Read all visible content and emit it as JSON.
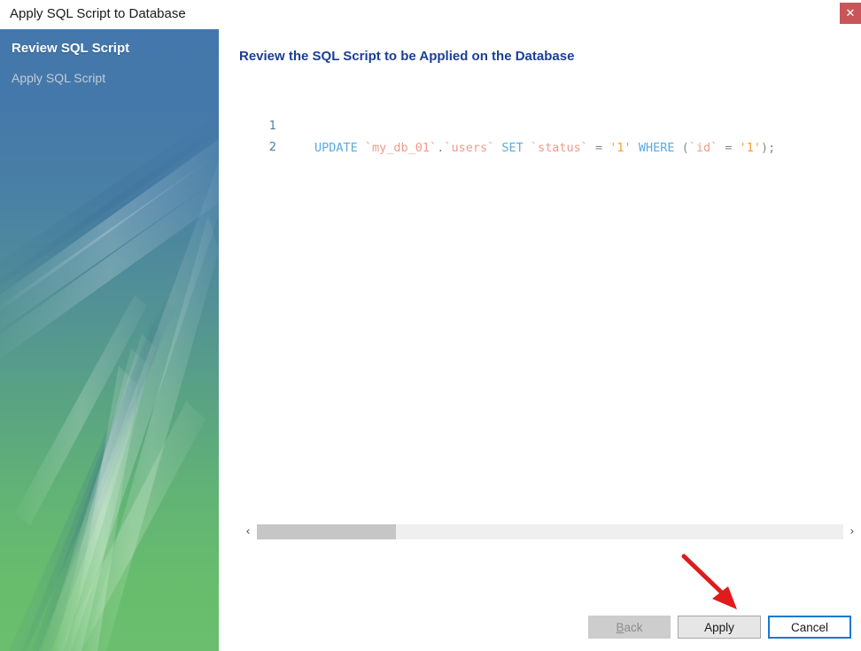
{
  "window": {
    "title": "Apply SQL Script to Database",
    "close_label": "✕",
    "close_color": "#c9555a"
  },
  "sidebar": {
    "steps": [
      {
        "label": "Review SQL Script",
        "state": "active"
      },
      {
        "label": "Apply SQL Script",
        "state": "inactive"
      }
    ],
    "gradient_from": "#4477ab",
    "gradient_to": "#6abe6e"
  },
  "main": {
    "heading": "Review the SQL Script to be Applied on the Database",
    "heading_color": "#1b3f94",
    "editor": {
      "lines": [
        {
          "number": "1",
          "tokens": [
            {
              "text": "UPDATE ",
              "type": "keyword"
            },
            {
              "text": "`my_db_01`",
              "type": "identifier"
            },
            {
              "text": ".",
              "type": "punctuation"
            },
            {
              "text": "`users`",
              "type": "identifier"
            },
            {
              "text": " SET ",
              "type": "keyword"
            },
            {
              "text": "`status`",
              "type": "identifier"
            },
            {
              "text": " = ",
              "type": "operator"
            },
            {
              "text": "'1'",
              "type": "string"
            },
            {
              "text": " WHERE ",
              "type": "keyword"
            },
            {
              "text": "(",
              "type": "punctuation"
            },
            {
              "text": "`id`",
              "type": "identifier"
            },
            {
              "text": " = ",
              "type": "operator"
            },
            {
              "text": "'1'",
              "type": "string"
            },
            {
              "text": ");",
              "type": "punctuation"
            }
          ],
          "plain": "UPDATE `my_db_01`.`users` SET `status` = '1' WHERE (`id` = '1');"
        },
        {
          "number": "2",
          "tokens": [],
          "plain": ""
        }
      ],
      "colors": {
        "keyword": "#5aaae0",
        "identifier": "#f09a8a",
        "string": "#f0a030",
        "operator": "#8a8a8a",
        "gutter": "#4a7fa5"
      }
    },
    "scrollbar": {
      "left_arrow": "‹",
      "right_arrow": "›",
      "thumb_position_percent": 0
    }
  },
  "footer": {
    "buttons": [
      {
        "name": "back",
        "label": "Back",
        "mnemonic": "B",
        "rest": "ack",
        "enabled": false,
        "focused": false
      },
      {
        "name": "apply",
        "label": "Apply",
        "enabled": true,
        "focused": false
      },
      {
        "name": "cancel",
        "label": "Cancel",
        "enabled": true,
        "focused": true
      }
    ]
  },
  "annotation": {
    "type": "arrow",
    "color": "#e01b1b",
    "points_at": "apply-button"
  }
}
